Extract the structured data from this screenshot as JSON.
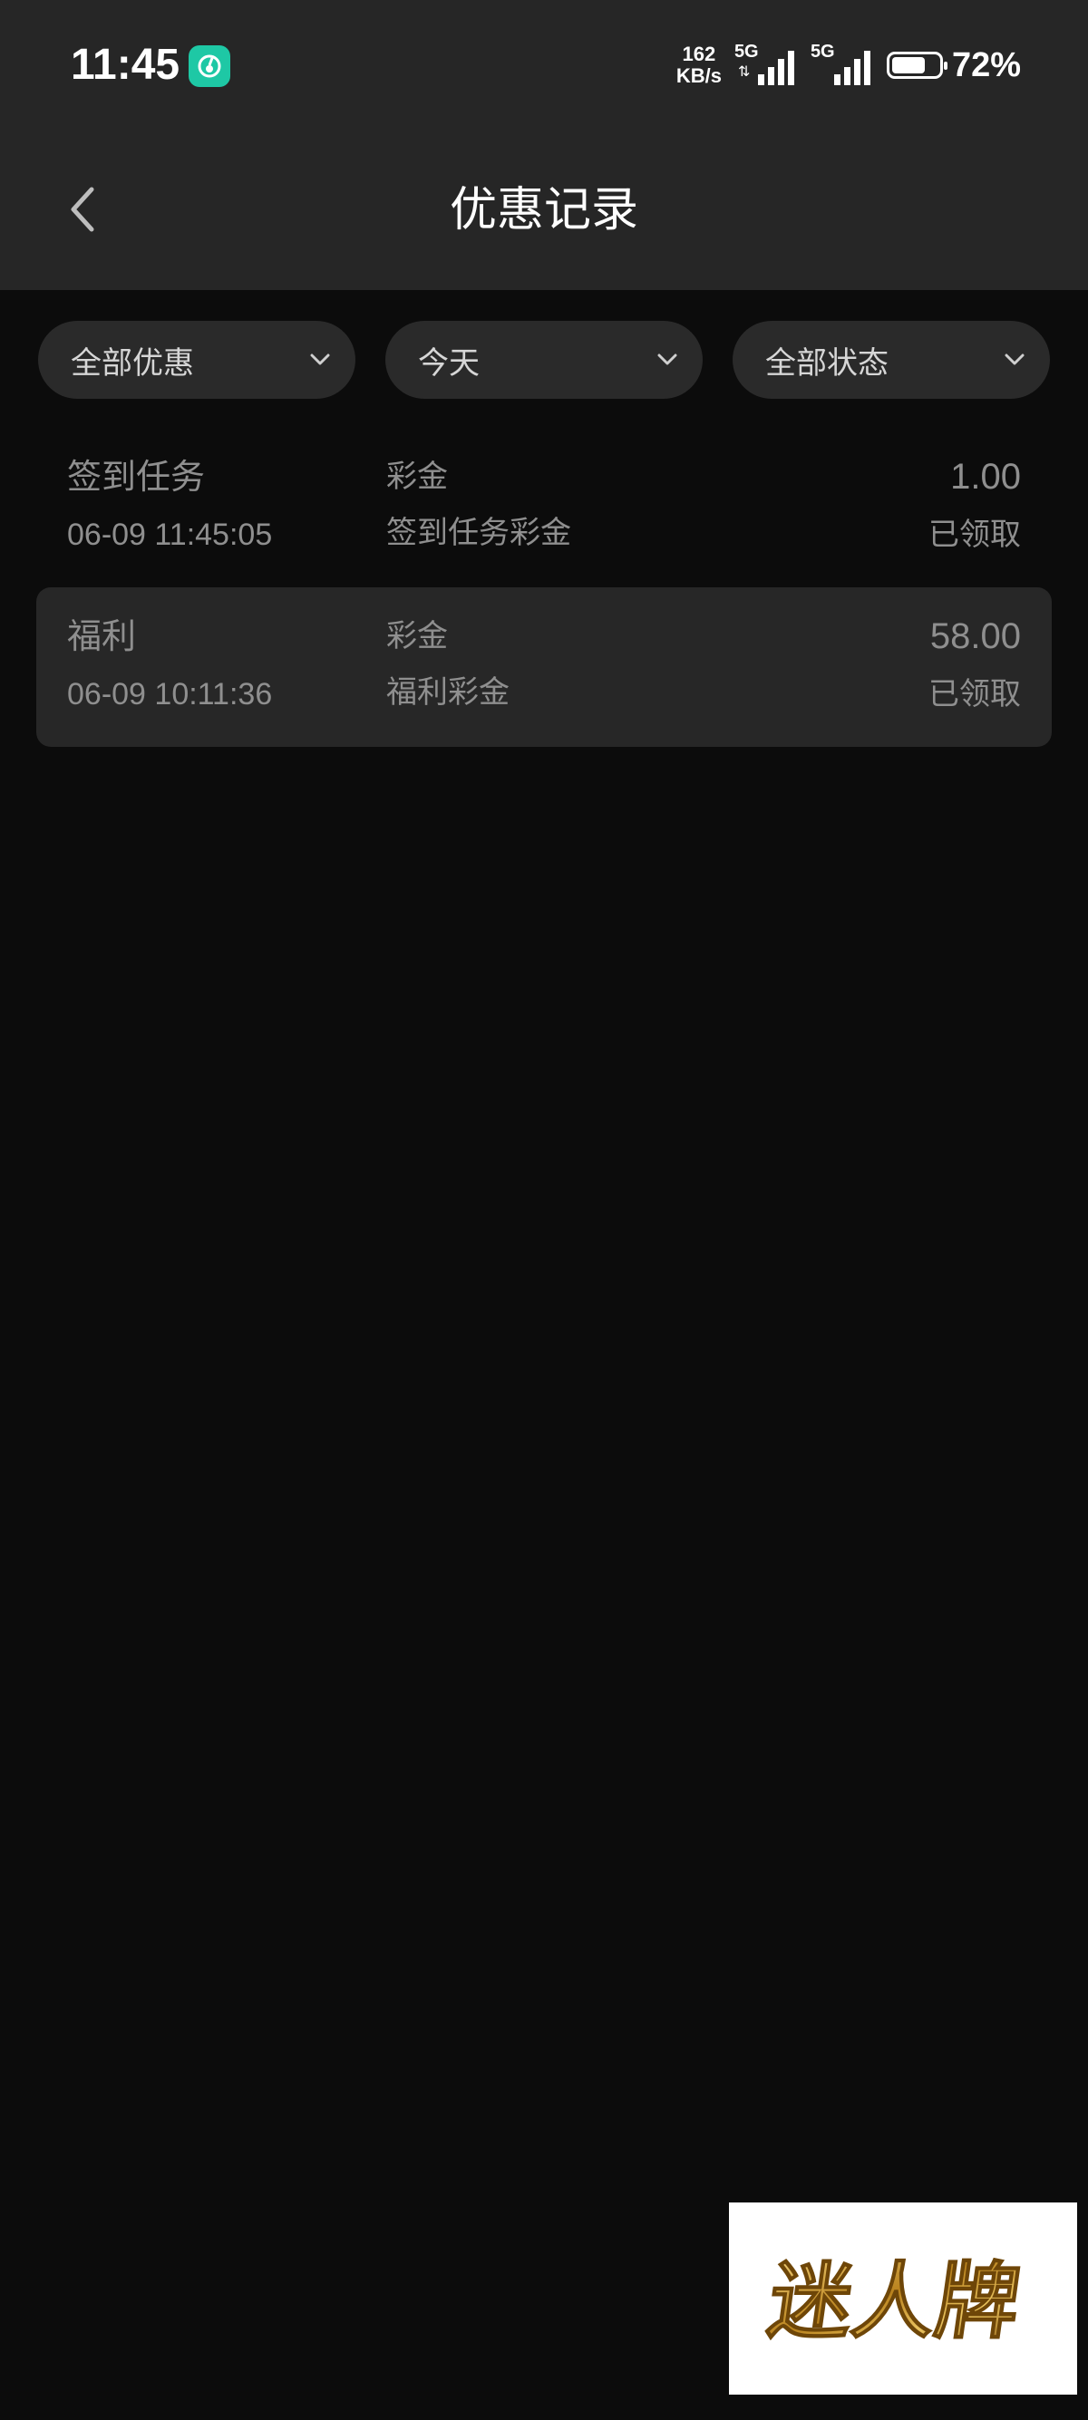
{
  "status_bar": {
    "time": "11:45",
    "net_speed_value": "162",
    "net_speed_unit": "KB/s",
    "sim1_label": "5G",
    "sim2_label": "5G",
    "battery_percent_text": "72%",
    "battery_level": 0.72
  },
  "header": {
    "title": "优惠记录"
  },
  "filters": {
    "type_label": "全部优惠",
    "date_label": "今天",
    "status_label": "全部状态"
  },
  "records": [
    {
      "name": "签到任务",
      "time": "06-09 11:45:05",
      "type": "彩金",
      "desc": "签到任务彩金",
      "amount": "1.00",
      "status": "已领取"
    },
    {
      "name": "福利",
      "time": "06-09 10:11:36",
      "type": "彩金",
      "desc": "福利彩金",
      "amount": "58.00",
      "status": "已领取"
    }
  ],
  "watermark": {
    "text": "迷人牌"
  },
  "colors": {
    "background": "#0c0c0c",
    "header_bg": "#262626",
    "pill_bg": "#2a2a2a",
    "row_alt_bg": "#272727",
    "muted_text": "#8f8f8f",
    "app_badge": "#1ec8a5",
    "watermark_gold": "#c8962a"
  }
}
